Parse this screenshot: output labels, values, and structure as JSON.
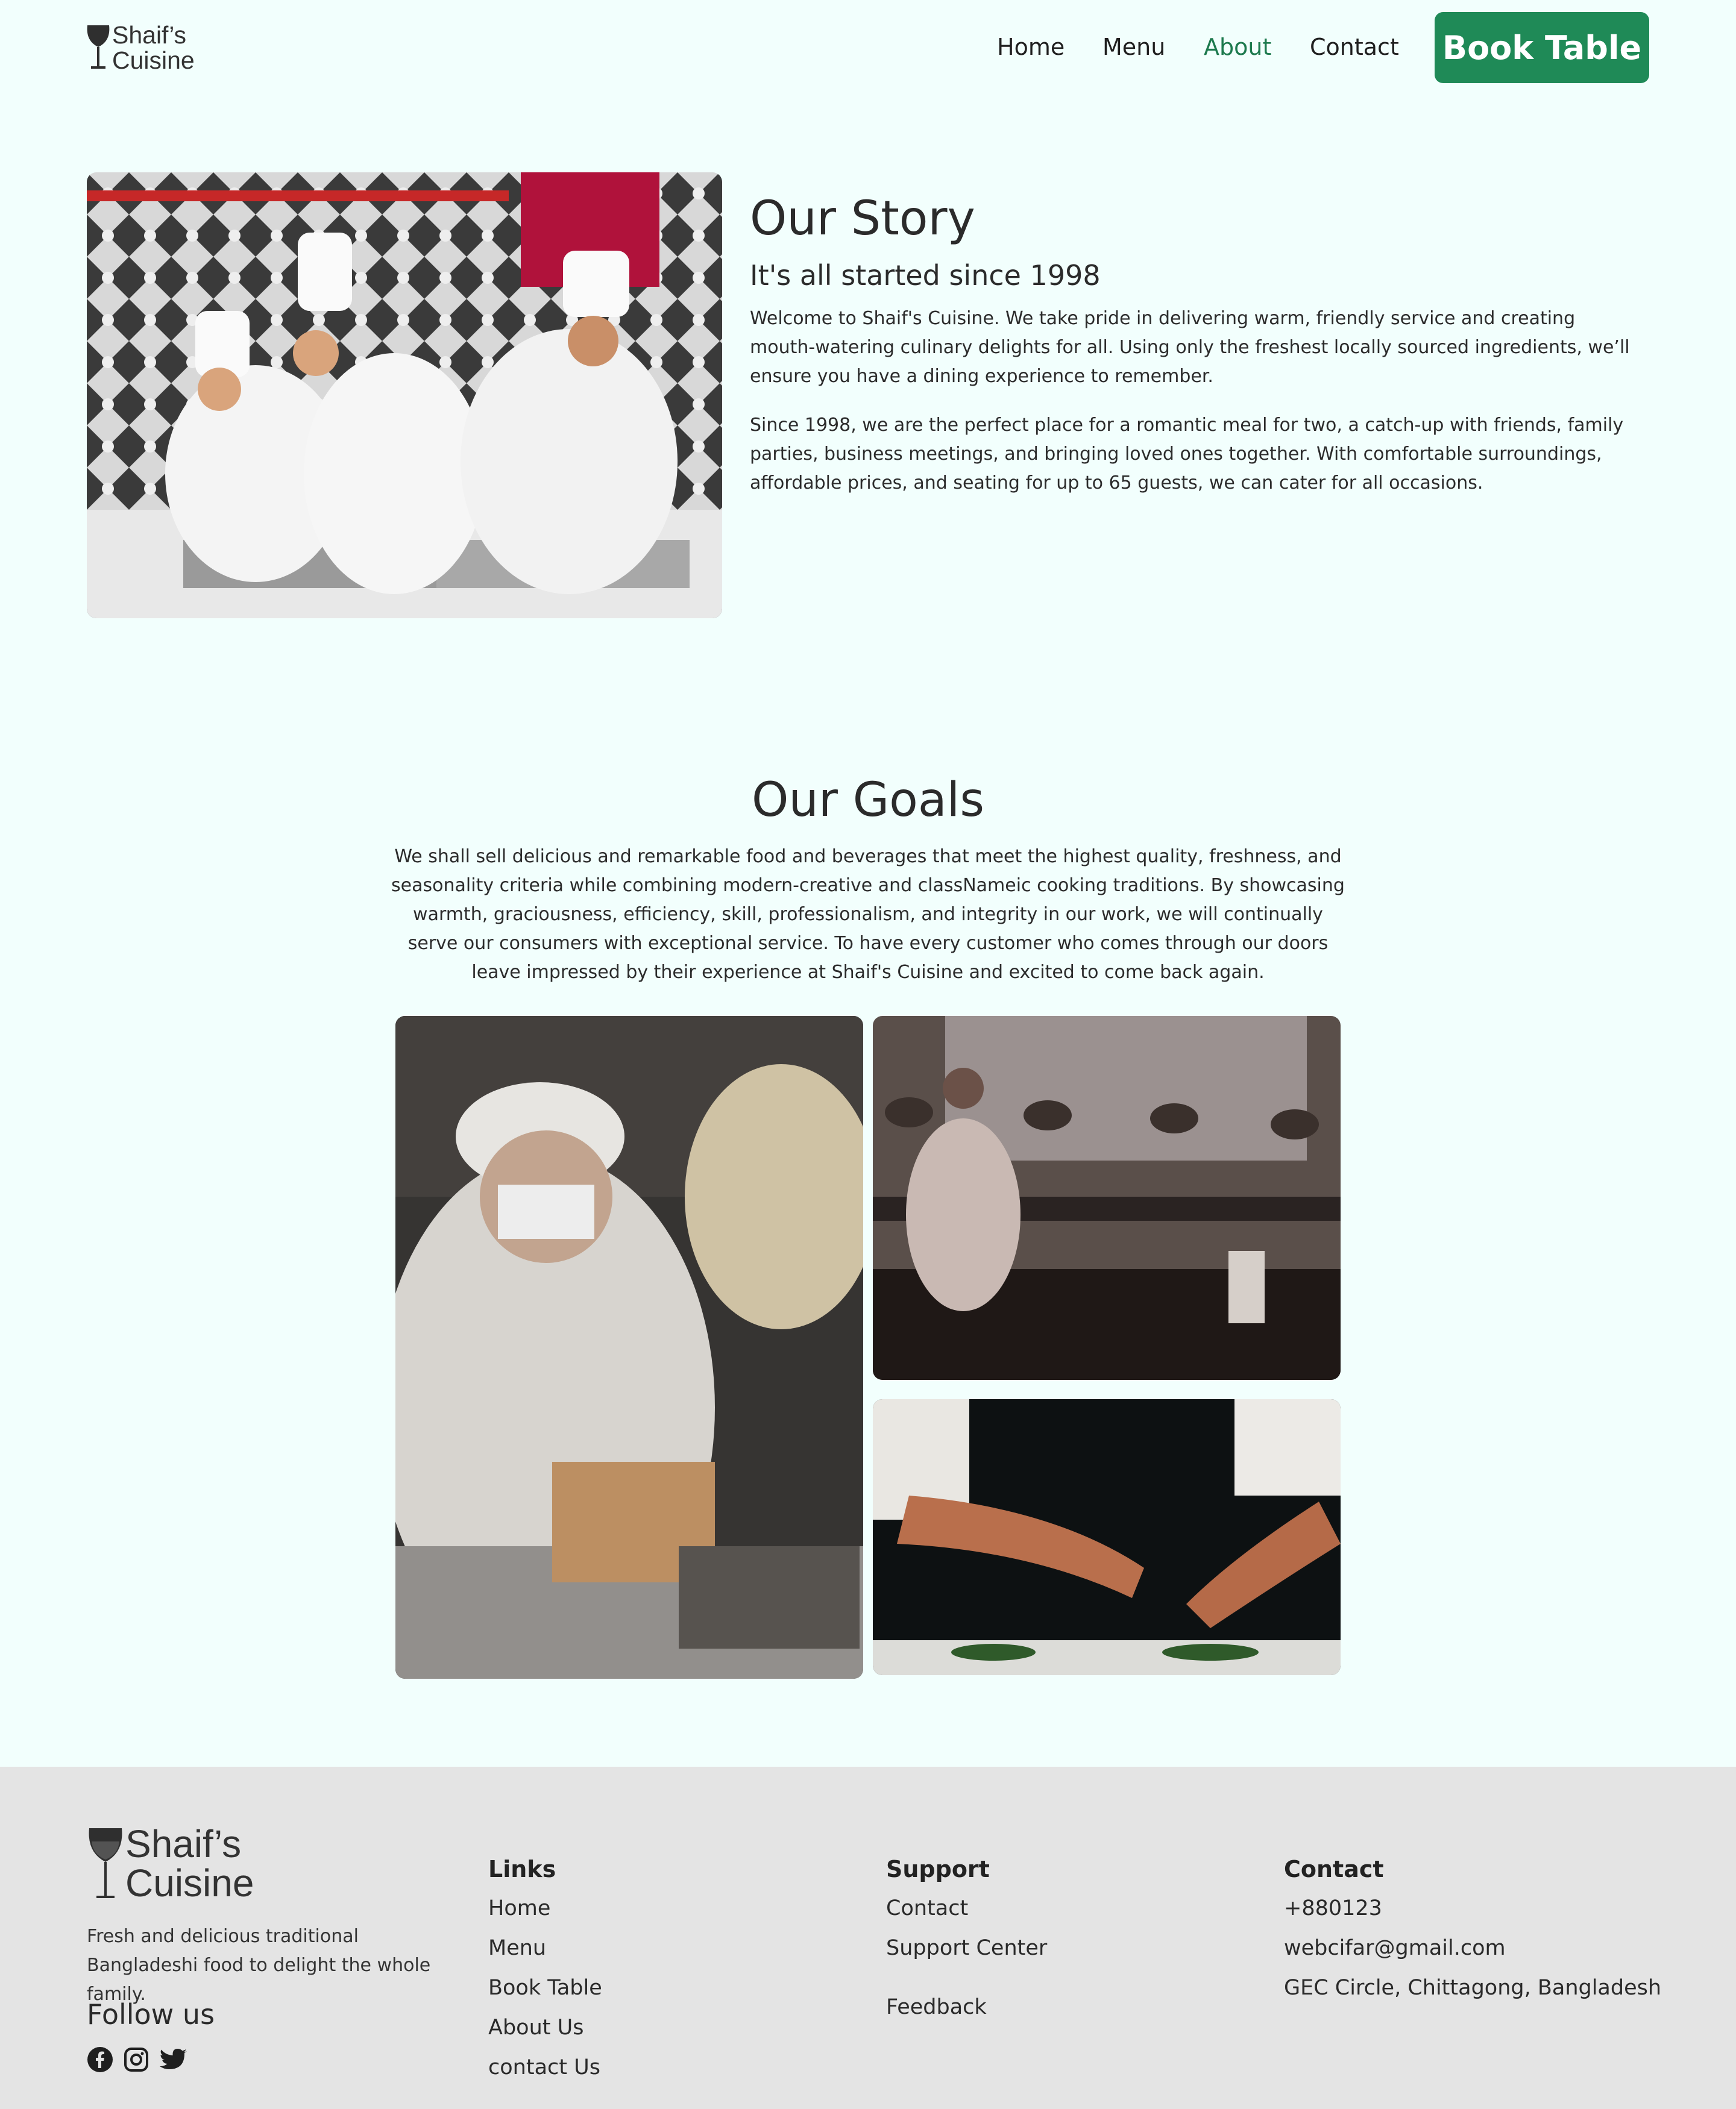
{
  "header": {
    "logo_line1": "Shaif’s",
    "logo_line2": "Cuisine",
    "nav": [
      "Home",
      "Menu",
      "About",
      "Contact"
    ],
    "active_nav": "About",
    "book_button": "Book Table",
    "accent_color": "#1f8a57"
  },
  "story": {
    "title": "Our Story",
    "subtitle": "It's all started since 1998",
    "paragraph1": "Welcome to Shaif's Cuisine. We take pride in delivering warm, friendly service and creating mouth-watering culinary delights for all. Using only the freshest locally sourced ingredients, we’ll ensure you have a dining experience to remember.",
    "paragraph2": "Since 1998, we are the perfect place for a romantic meal for two, a catch-up with friends, family parties, business meetings, and bringing loved ones together. With comfortable surroundings, affordable prices, and seating for up to 65 guests, we can cater for all occasions."
  },
  "goals": {
    "title": "Our Goals",
    "paragraph": "We shall sell delicious and remarkable food and beverages that meet the highest quality, freshness, and seasonality criteria while combining modern-creative and classNameic cooking traditions. By showcasing warmth, graciousness, efficiency, skill, professionalism, and integrity in our work, we will continually serve our consumers with exceptional service. To have every customer who comes through our doors leave impressed by their experience at Shaif's Cuisine and excited to come back again."
  },
  "footer": {
    "logo_line1": "Shaif’s",
    "logo_line2": "Cuisine",
    "tagline": "Fresh and delicious traditional Bangladeshi food to delight the whole family.",
    "follow_title": "Follow us",
    "social_icons": [
      "facebook-icon",
      "instagram-icon",
      "twitter-icon"
    ],
    "links_title": "Links",
    "links": [
      "Home",
      "Menu",
      "Book Table",
      "About Us",
      "contact Us"
    ],
    "support_title": "Support",
    "support": [
      "Contact",
      "Support Center",
      "Feedback"
    ],
    "contact_title": "Contact",
    "contact": [
      "+880123",
      "webcifar@gmail.com",
      "GEC Circle, Chittagong, Bangladesh"
    ]
  }
}
